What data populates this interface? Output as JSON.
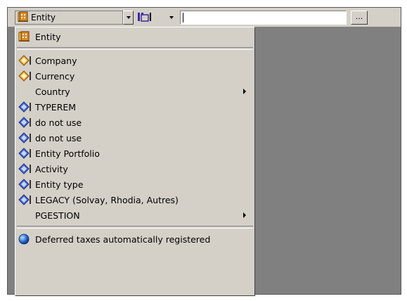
{
  "toolbar": {
    "combo_value": "Entity",
    "combo_icon": "entity-icon",
    "view_icon": "table-view-icon",
    "text_value": "",
    "browse_label": "..."
  },
  "menu": {
    "header": {
      "label": "Entity",
      "icon": "entity-icon"
    },
    "groupA": [
      {
        "label": "Company",
        "icon": "dimension-diamond-icon"
      },
      {
        "label": "Currency",
        "icon": "dimension-diamond-icon"
      },
      {
        "label": "Country",
        "icon": "",
        "submenu": true
      },
      {
        "label": "TYPEREM",
        "icon": "book-icon"
      },
      {
        "label": "do not use",
        "icon": "book-icon"
      },
      {
        "label": "do not use",
        "icon": "book-icon"
      },
      {
        "label": "Entity Portfolio",
        "icon": "book-icon"
      },
      {
        "label": "Activity",
        "icon": "book-icon"
      },
      {
        "label": "Entity type",
        "icon": "book-icon"
      },
      {
        "label": "LEGACY (Solvay, Rhodia, Autres)",
        "icon": "book-icon"
      },
      {
        "label": "PGESTION",
        "icon": "",
        "submenu": true
      }
    ],
    "footer": {
      "label": "Deferred taxes automatically registered",
      "icon": "globe-icon"
    }
  }
}
